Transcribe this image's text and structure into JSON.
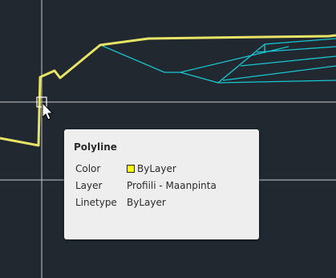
{
  "colors": {
    "background": "#212830",
    "crosshair": "#c8ccd0",
    "polyline_highlight": "#e8e466",
    "cyan_lines": "#19c7d2",
    "tooltip_bg": "#eeeeee",
    "swatch_yellow": "#ffff00"
  },
  "icons": {
    "cursor": "mouse-pointer-icon",
    "pickbox": "pickbox-icon"
  },
  "tooltip": {
    "title": "Polyline",
    "rows": [
      {
        "key": "Color",
        "value": "ByLayer",
        "swatch": "#ffff00"
      },
      {
        "key": "Layer",
        "value": "Profiili - Maanpinta"
      },
      {
        "key": "Linetype",
        "value": "ByLayer"
      }
    ]
  }
}
